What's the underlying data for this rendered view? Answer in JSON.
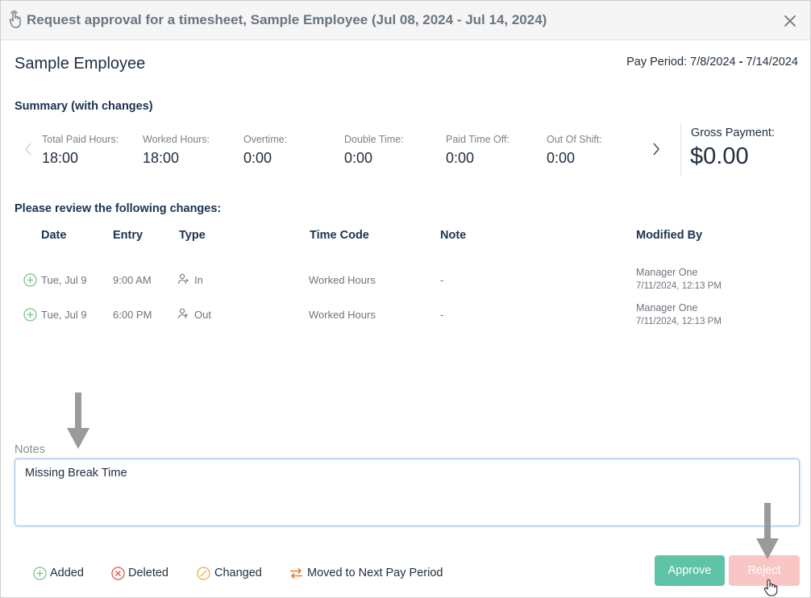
{
  "dialog": {
    "title": "Request approval for a timesheet, Sample Employee (Jul 08, 2024 - Jul 14, 2024)",
    "close_icon": "close-icon",
    "title_icon": "touch-hand-icon"
  },
  "employee": {
    "name": "Sample Employee",
    "pay_period_label": "Pay Period:",
    "pay_period_start": "7/8/2024",
    "pay_period_sep": "-",
    "pay_period_end": "7/14/2024"
  },
  "summary": {
    "title": "Summary (with changes)",
    "metrics": [
      {
        "label": "Total Paid Hours:",
        "value": "18:00"
      },
      {
        "label": "Worked Hours:",
        "value": "18:00"
      },
      {
        "label": "Overtime:",
        "value": "0:00"
      },
      {
        "label": "Double Time:",
        "value": "0:00"
      },
      {
        "label": "Paid Time Off:",
        "value": "0:00"
      },
      {
        "label": "Out Of Shift:",
        "value": "0:00"
      }
    ],
    "gross_label": "Gross Payment:",
    "gross_value": "$0.00"
  },
  "changes": {
    "title": "Please review the following changes:",
    "columns": {
      "date": "Date",
      "entry": "Entry",
      "type": "Type",
      "time_code": "Time Code",
      "note": "Note",
      "modified_by": "Modified By"
    },
    "rows": [
      {
        "date": "Tue, Jul 9",
        "entry": "9:00 AM",
        "type": "In",
        "time_code": "Worked Hours",
        "note": "-",
        "modified_by": "Manager One",
        "modified_at": "7/11/2024, 12:13 PM"
      },
      {
        "date": "Tue, Jul 9",
        "entry": "6:00 PM",
        "type": "Out",
        "time_code": "Worked Hours",
        "note": "-",
        "modified_by": "Manager One",
        "modified_at": "7/11/2024, 12:13 PM"
      }
    ]
  },
  "notes": {
    "label": "Notes",
    "value": "Missing Break Time"
  },
  "legend": {
    "added": "Added",
    "deleted": "Deleted",
    "changed": "Changed",
    "moved": "Moved to Next Pay Period"
  },
  "actions": {
    "approve": "Approve",
    "reject": "Reject"
  },
  "colors": {
    "added": "#7cc08f",
    "deleted": "#e0524d",
    "changed": "#f0a84a",
    "moved": "#f07a2a",
    "approve": "#5fc3a8",
    "reject": "#f9c6c6"
  }
}
